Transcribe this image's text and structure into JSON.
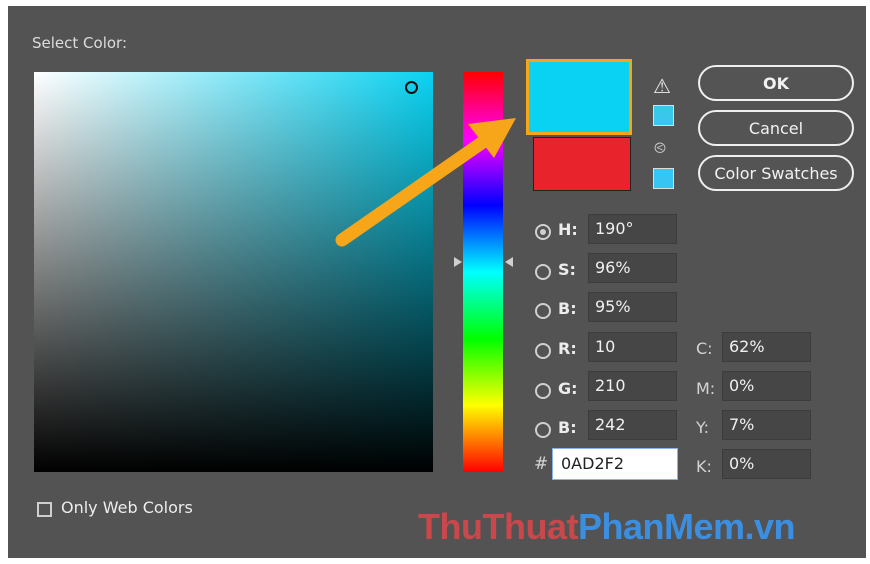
{
  "dialog": {
    "title": "Select Color:",
    "current_color": "#0AD2F2",
    "previous_color": "#E8232B",
    "hue_degrees": 190,
    "buttons": {
      "ok": "OK",
      "cancel": "Cancel",
      "swatches": "Color Swatches"
    }
  },
  "fields": {
    "h": {
      "label": "H:",
      "value": "190°",
      "selected": true
    },
    "s": {
      "label": "S:",
      "value": "96%"
    },
    "b_hsb": {
      "label": "B:",
      "value": "95%"
    },
    "r": {
      "label": "R:",
      "value": "10"
    },
    "g": {
      "label": "G:",
      "value": "210"
    },
    "b_rgb": {
      "label": "B:",
      "value": "242"
    },
    "c": {
      "label": "C:",
      "value": "62%"
    },
    "m": {
      "label": "M:",
      "value": "0%"
    },
    "y": {
      "label": "Y:",
      "value": "7%"
    },
    "k": {
      "label": "K:",
      "value": "0%"
    },
    "hex": {
      "label": "#",
      "value": "0AD2F2"
    }
  },
  "options": {
    "only_web_colors": "Only Web Colors",
    "only_web_colors_checked": false
  },
  "icons": {
    "warning": "warning-triangle-icon",
    "cube": "cube-icon"
  },
  "watermark": {
    "part1": "ThuThuat",
    "part2": "PhanMem.vn"
  },
  "annotation": {
    "arrow_color": "#F6A618"
  }
}
